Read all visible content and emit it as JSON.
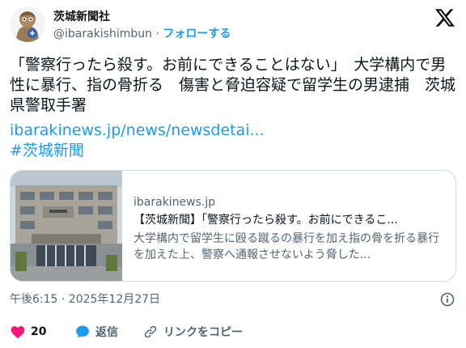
{
  "author": {
    "name": "茨城新聞社",
    "handle": "@ibarakishimbun",
    "separator": "·",
    "follow_label": "フォローする"
  },
  "tweet": {
    "text": "「警察行ったら殺す。お前にできることはない」　大学構内で男性に暴行、指の骨折る　傷害と脅迫容疑で留学生の男逮捕　茨城県警取手署",
    "link_text": "ibarakinews.jp/news/newsdetai...",
    "hashtag": "#茨城新聞"
  },
  "card": {
    "domain": "ibarakinews.jp",
    "title": "【茨城新聞】「警察行ったら殺す。お前にできるこ...",
    "description": "大学構内で留学生に殴る蹴るの暴行を加え指の骨を折る暴行を加えた上、警察へ通報させないよう脅した..."
  },
  "timestamp": "午後6:15 · 2025年12月27日",
  "actions": {
    "like_count": "20",
    "reply_label": "返信",
    "copy_label": "リンクをコピー"
  },
  "colors": {
    "accent": "#1d9bf0",
    "like": "#f91880",
    "secondary_text": "#536471"
  },
  "icons": [
    "mascot-avatar",
    "x-logo-icon",
    "info-icon",
    "heart-icon",
    "reply-bubble-icon",
    "link-icon"
  ]
}
